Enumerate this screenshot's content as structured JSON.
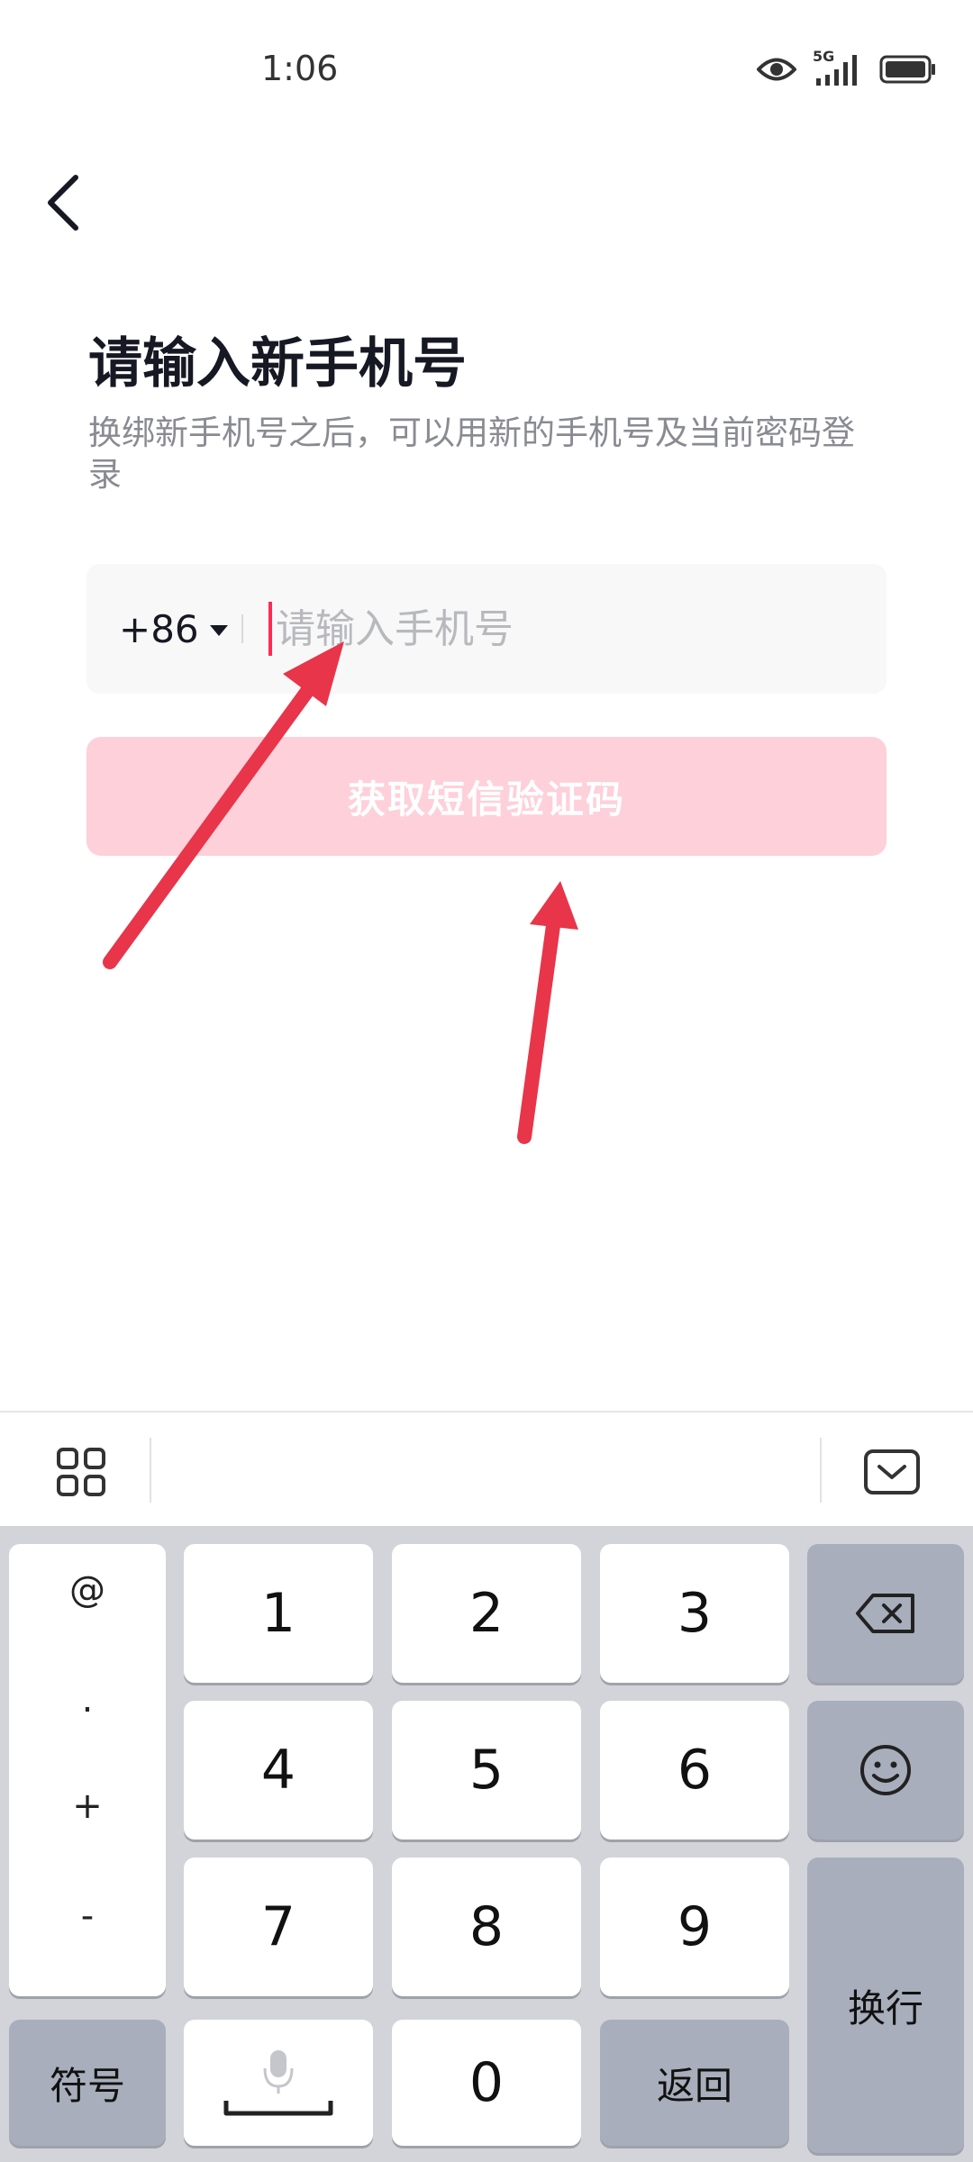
{
  "status_bar": {
    "time": "1:06",
    "network": "5G"
  },
  "header": {
    "back_icon": "chevron-left-icon"
  },
  "main": {
    "title": "请输入新手机号",
    "subtitle": "换绑新手机号之后，可以用新的手机号及当前密码登录",
    "country_code": "+86",
    "phone_input": {
      "value": "",
      "placeholder": "请输入手机号"
    },
    "sms_button_label": "获取短信验证码"
  },
  "keyboard_toolbar": {
    "left_icon": "grid-icon",
    "right_icon": "keyboard-hide-icon"
  },
  "keyboard": {
    "symbols": [
      "@",
      ".",
      "+",
      "-"
    ],
    "digits": [
      "1",
      "2",
      "3",
      "4",
      "5",
      "6",
      "7",
      "8",
      "9",
      "0"
    ],
    "symbol_switch_label": "符号",
    "return_label": "返回",
    "newline_label": "换行",
    "backspace_icon": "backspace-icon",
    "emoji_icon": "emoji-icon",
    "voice_space_icon": "microphone-space-icon"
  },
  "colors": {
    "accent": "#fe2c55",
    "button_disabled": "#fed0da",
    "annotation_arrow": "#e8354a"
  }
}
